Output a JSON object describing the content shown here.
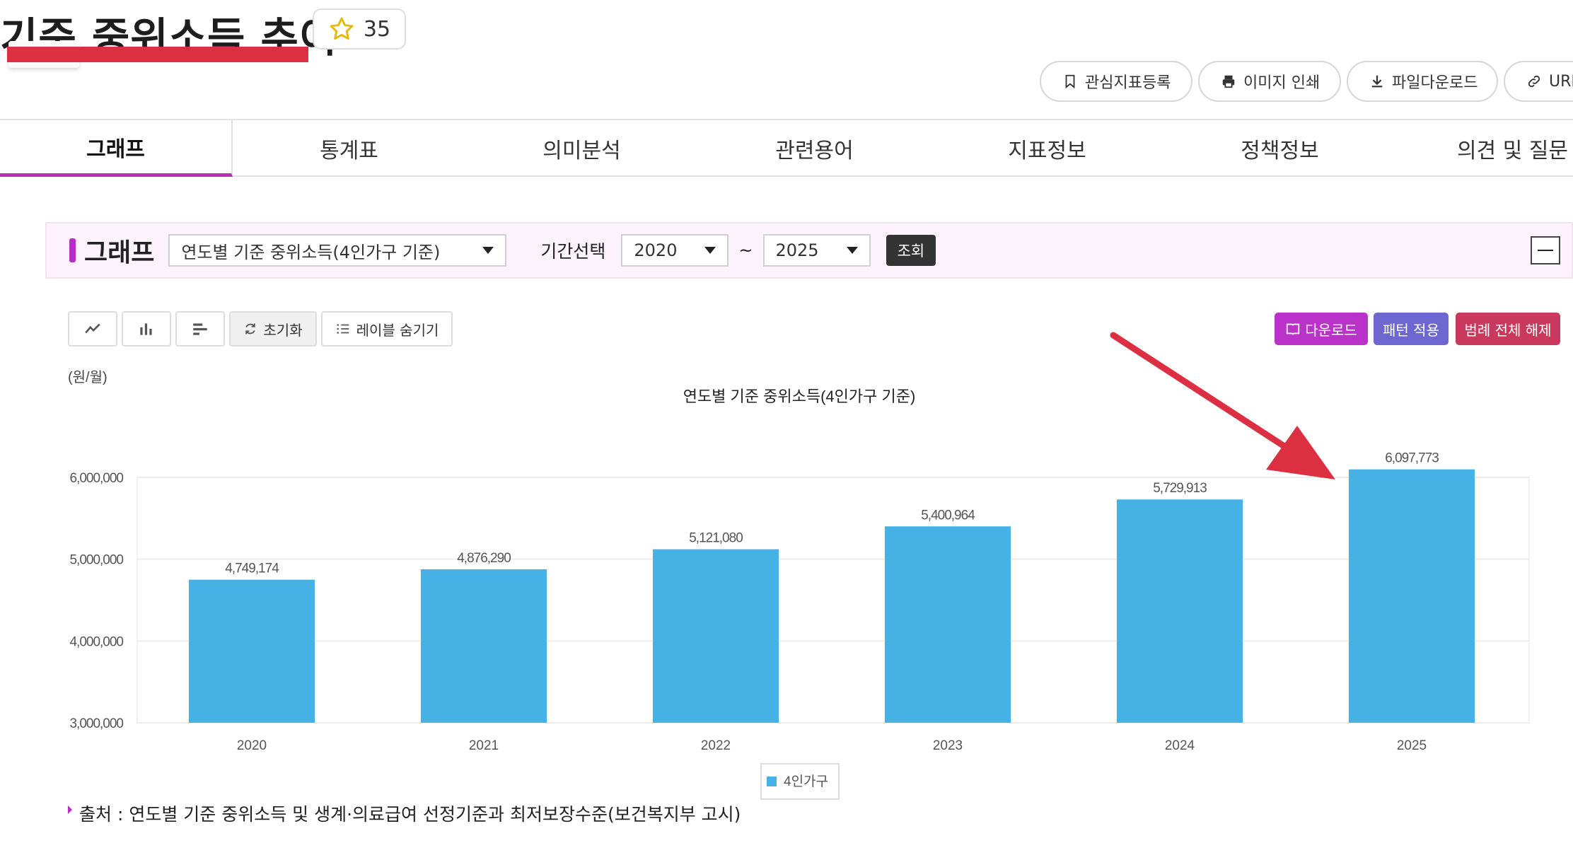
{
  "header": {
    "title": "기준 중위소득 추이",
    "star_count": "35",
    "actions": [
      "관심지표등록",
      "이미지 인쇄",
      "파일다운로드",
      "URL"
    ]
  },
  "tabs": [
    "그래프",
    "통계표",
    "의미분석",
    "관련용어",
    "지표정보",
    "정책정보",
    "의견 및 질문"
  ],
  "graph_bar": {
    "label": "그래프",
    "indicator_select": "연도별 기준 중위소득(4인가구 기준)",
    "period_label": "기간선택",
    "from_year": "2020",
    "tilde": "~",
    "to_year": "2025",
    "search_label": "조회"
  },
  "toolbar": {
    "reset_label": "초기화",
    "hide_labels": "레이블 숨기기",
    "download": "다운로드",
    "pattern": "패턴 적용",
    "legend_off": "범례 전체 해제"
  },
  "colors": {
    "bar": "#45b1e4",
    "accent": "#b52fc4",
    "download_btn": "#b933c9",
    "pattern_btn": "#6d67cf",
    "legend_btn": "#c9395e",
    "arrow": "#dc2f42"
  },
  "chart_data": {
    "type": "bar",
    "title": "연도별 기준 중위소득(4인가구 기준)",
    "unit_label": "(원/월)",
    "categories": [
      "2020",
      "2021",
      "2022",
      "2023",
      "2024",
      "2025"
    ],
    "series": [
      {
        "name": "4인가구",
        "values": [
          4749174,
          4876290,
          5121080,
          5400964,
          5729913,
          6097773
        ]
      }
    ],
    "value_labels": [
      "4,749,174",
      "4,876,290",
      "5,121,080",
      "5,400,964",
      "5,729,913",
      "6,097,773"
    ],
    "ylim": [
      3000000,
      6000000
    ],
    "yticks": [
      3000000,
      4000000,
      5000000,
      6000000
    ],
    "ytick_labels": [
      "3,000,000",
      "4,000,000",
      "5,000,000",
      "6,000,000"
    ],
    "grid": true,
    "legend_position": "bottom"
  },
  "source": "출처 : 연도별 기준 중위소득 및 생계·의료급여 선정기준과 최저보장수준(보건복지부 고시)"
}
